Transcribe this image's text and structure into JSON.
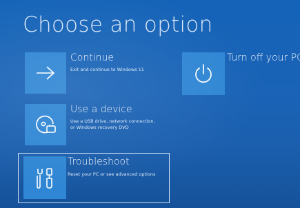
{
  "page": {
    "title": "Choose an option"
  },
  "options": {
    "continue": {
      "title": "Continue",
      "description": "Exit and continue to Windows 11",
      "icon": "arrow-right-icon"
    },
    "use_device": {
      "title": "Use a device",
      "description_line1": "Use a USB drive, network connection,",
      "description_line2": "or Windows recovery DVD",
      "icon": "device-disc-icon"
    },
    "troubleshoot": {
      "title": "Troubleshoot",
      "description": "Reset your PC or see advanced options",
      "icon": "tools-icon",
      "selected": true
    },
    "turn_off": {
      "title": "Turn off your PC",
      "icon": "power-icon"
    }
  },
  "colors": {
    "background": "#1a63b6",
    "tile": "#2f86d4",
    "selection_border": "#cfe0f4",
    "text": "#ffffff"
  }
}
